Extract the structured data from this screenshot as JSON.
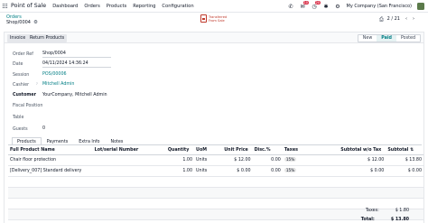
{
  "topbar": {
    "app_title": "Point of Sale",
    "menu": [
      "Dashboard",
      "Orders",
      "Products",
      "Reporting",
      "Configuration"
    ],
    "badges": {
      "chat": "10",
      "activity": "20"
    },
    "company": "My Company (San Francisco)"
  },
  "control": {
    "breadcrumb": "Orders",
    "record_name": "Shop/0004",
    "cloud_label": "Transferred From Sale",
    "pager": "2 / 21"
  },
  "status": {
    "buttons": [
      "Invoice",
      "Return Products"
    ],
    "stages": [
      "New",
      "Paid",
      "Posted"
    ],
    "active_stage": "Paid"
  },
  "form": {
    "order_ref": {
      "label": "Order Ref",
      "value": "Shop/0004"
    },
    "date": {
      "label": "Date",
      "value": "04/11/2024 14:36:24"
    },
    "session": {
      "label": "Session",
      "value": "POS/00006"
    },
    "cashier": {
      "label": "Cashier",
      "value": "Mitchell Admin"
    },
    "customer": {
      "label": "Customer",
      "value": "YourCompany, Mitchell Admin"
    },
    "fiscal_position": {
      "label": "Fiscal Position",
      "value": ""
    },
    "table": {
      "label": "Table",
      "value": ""
    },
    "guests": {
      "label": "Guests",
      "value": "0"
    }
  },
  "tabs": [
    "Products",
    "Payments",
    "Extra Info",
    "Notes"
  ],
  "lines": {
    "headers": {
      "product": "Full Product Name",
      "lot": "Lot/serial Number",
      "qty": "Quantity",
      "uom": "UoM",
      "price": "Unit Price",
      "disc": "Disc.%",
      "taxes": "Taxes",
      "subtotal_wo": "Subtotal w/o Tax",
      "subtotal": "Subtotal"
    },
    "rows": [
      {
        "product": "Chair floor protection",
        "lot": "",
        "qty": "1.00",
        "uom": "Units",
        "price": "$ 12.00",
        "disc": "0.00",
        "taxes": "15%",
        "subtotal_wo": "$ 12.00",
        "subtotal": "$ 13.80"
      },
      {
        "product": "[Delivery_007] Standard delivery",
        "lot": "",
        "qty": "1.00",
        "uom": "Units",
        "price": "$ 0.00",
        "disc": "0.00",
        "taxes": "15%",
        "subtotal_wo": "$ 0.00",
        "subtotal": "$ 0.00"
      }
    ]
  },
  "totals": {
    "taxes_label": "Taxes:",
    "taxes_value": "$ 1.80",
    "total_label": "Total:",
    "total_value": "$ 13.80"
  }
}
